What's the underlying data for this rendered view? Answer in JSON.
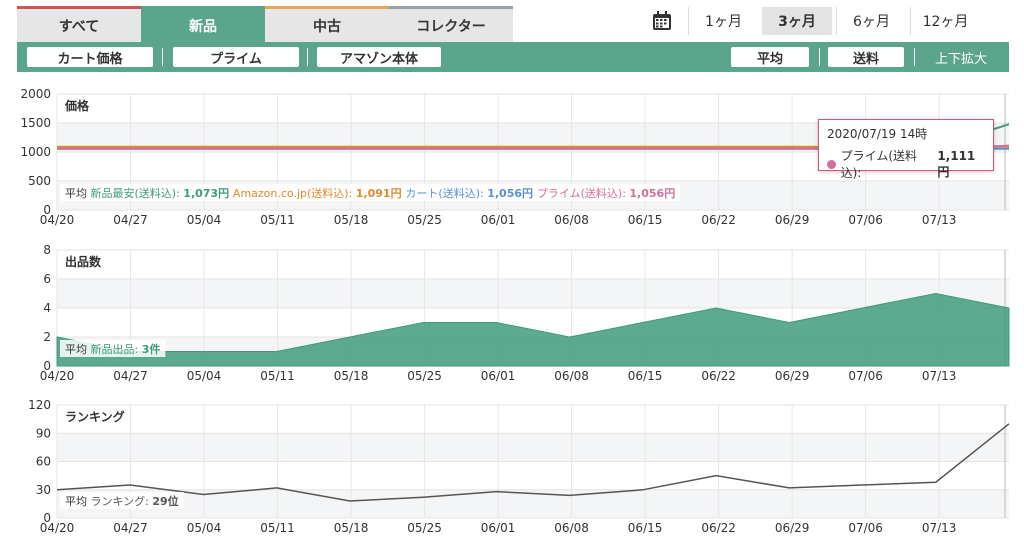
{
  "tabs": [
    {
      "label": "すべて"
    },
    {
      "label": "新品"
    },
    {
      "label": "中古"
    },
    {
      "label": "コレクター"
    }
  ],
  "ranges": {
    "items": [
      {
        "label": "1ヶ月"
      },
      {
        "label": "3ヶ月"
      },
      {
        "label": "6ヶ月"
      },
      {
        "label": "12ヶ月"
      }
    ],
    "selected": "3ヶ月"
  },
  "toolbar": {
    "cart": "カート価格",
    "prime": "プライム",
    "amazon": "アマゾン本体",
    "avg": "平均",
    "shipping": "送料",
    "zoom": "上下拡大"
  },
  "colors": {
    "accent": "#5aa58c",
    "new": "#3f9b7d",
    "amazon": "#e08a2c",
    "cart": "#5b8fd6",
    "prime": "#d0709a",
    "rank": "#555555"
  },
  "tooltip": {
    "time": "2020/07/19 14時",
    "label": "プライム(送料込):",
    "value": "1,111円"
  },
  "chart_data": [
    {
      "type": "line",
      "title": "価格",
      "x": [
        "04/20",
        "04/27",
        "05/04",
        "05/11",
        "05/18",
        "05/25",
        "06/01",
        "06/08",
        "06/15",
        "06/22",
        "06/29",
        "07/06",
        "07/13"
      ],
      "ylim": [
        0,
        2000
      ],
      "yticks": [
        "0",
        "500",
        "1000",
        "1500",
        "2000"
      ],
      "series": [
        {
          "name": "新品最安(送料込)",
          "values": [
            1073,
            1073,
            1073,
            1073,
            1073,
            1073,
            1073,
            1073,
            1073,
            1073,
            1073,
            1073,
            1073,
            1480
          ]
        },
        {
          "name": "Amazon.co.jp(送料込)",
          "values": [
            1091,
            1091,
            1091,
            1091,
            1091,
            1091,
            1091,
            1091,
            1091,
            1091,
            1091,
            1091,
            1091,
            1091
          ]
        },
        {
          "name": "カート(送料込)",
          "values": [
            1056,
            1056,
            1056,
            1056,
            1056,
            1056,
            1056,
            1056,
            1056,
            1056,
            1056,
            1056,
            1056,
            1056
          ]
        },
        {
          "name": "プライム(送料込)",
          "values": [
            1056,
            1056,
            1056,
            1056,
            1056,
            1056,
            1056,
            1056,
            1056,
            1056,
            1056,
            1056,
            1056,
            1111
          ]
        }
      ],
      "avg": {
        "label": "平均",
        "items": [
          {
            "name": "新品最安(送料込):",
            "value": "1,073円"
          },
          {
            "name": "Amazon.co.jp(送料込):",
            "value": "1,091円"
          },
          {
            "name": "カート(送料込):",
            "value": "1,056円"
          },
          {
            "name": "プライム(送料込):",
            "value": "1,056円"
          }
        ]
      }
    },
    {
      "type": "area",
      "title": "出品数",
      "x": [
        "04/20",
        "04/27",
        "05/04",
        "05/11",
        "05/18",
        "05/25",
        "06/01",
        "06/08",
        "06/15",
        "06/22",
        "06/29",
        "07/06",
        "07/13"
      ],
      "ylim": [
        0,
        8
      ],
      "yticks": [
        "0",
        "2",
        "4",
        "6",
        "8"
      ],
      "series": [
        {
          "name": "新品出品",
          "values": [
            2,
            1,
            1,
            1,
            2,
            3,
            3,
            2,
            3,
            4,
            3,
            4,
            5,
            4
          ]
        }
      ],
      "avg": {
        "label": "平均",
        "items": [
          {
            "name": "新品出品:",
            "value": "3件"
          }
        ]
      }
    },
    {
      "type": "line",
      "title": "ランキング",
      "x": [
        "04/20",
        "04/27",
        "05/04",
        "05/11",
        "05/18",
        "05/25",
        "06/01",
        "06/08",
        "06/15",
        "06/22",
        "06/29",
        "07/06",
        "07/13"
      ],
      "ylim": [
        0,
        120
      ],
      "yticks": [
        "0",
        "30",
        "60",
        "90",
        "120"
      ],
      "series": [
        {
          "name": "ランキング",
          "values": [
            30,
            35,
            25,
            32,
            18,
            22,
            28,
            24,
            30,
            45,
            32,
            35,
            38,
            100
          ]
        }
      ],
      "avg": {
        "label": "平均",
        "items": [
          {
            "name": "ランキング:",
            "value": "29位"
          }
        ]
      }
    }
  ]
}
